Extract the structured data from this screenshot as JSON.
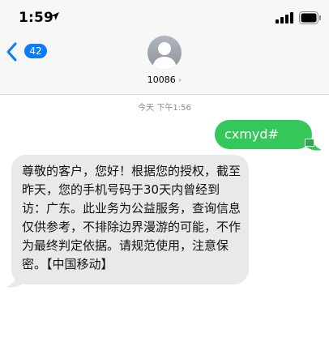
{
  "status_bar": {
    "time": "1:59",
    "location_icon": "location-arrow-icon",
    "signal_icon": "cellular-signal-icon",
    "battery_icon": "battery-icon"
  },
  "header": {
    "back_icon": "chevron-left-icon",
    "unread_count": "42",
    "avatar_icon": "person-avatar-icon",
    "contact_name": "10086",
    "contact_chevron": "›"
  },
  "conversation": {
    "timestamp": "今天 下午1:56",
    "messages": [
      {
        "direction": "sent",
        "text": "cxmyd#"
      },
      {
        "direction": "received",
        "text": "尊敬的客户，您好！根据您的授权，截至昨天，您的手机号码于30天内曾经到访：广东。此业务为公益服务，查询信息仅供参考，不排除边界漫游的可能，不作为最终判定依据。请规范使用，注意保密。【中国移动】"
      }
    ]
  },
  "colors": {
    "accent": "#0a7cff",
    "sent_bubble": "#34c759",
    "received_bubble": "#e9e9eb",
    "header_bg": "#f7f7f7"
  }
}
